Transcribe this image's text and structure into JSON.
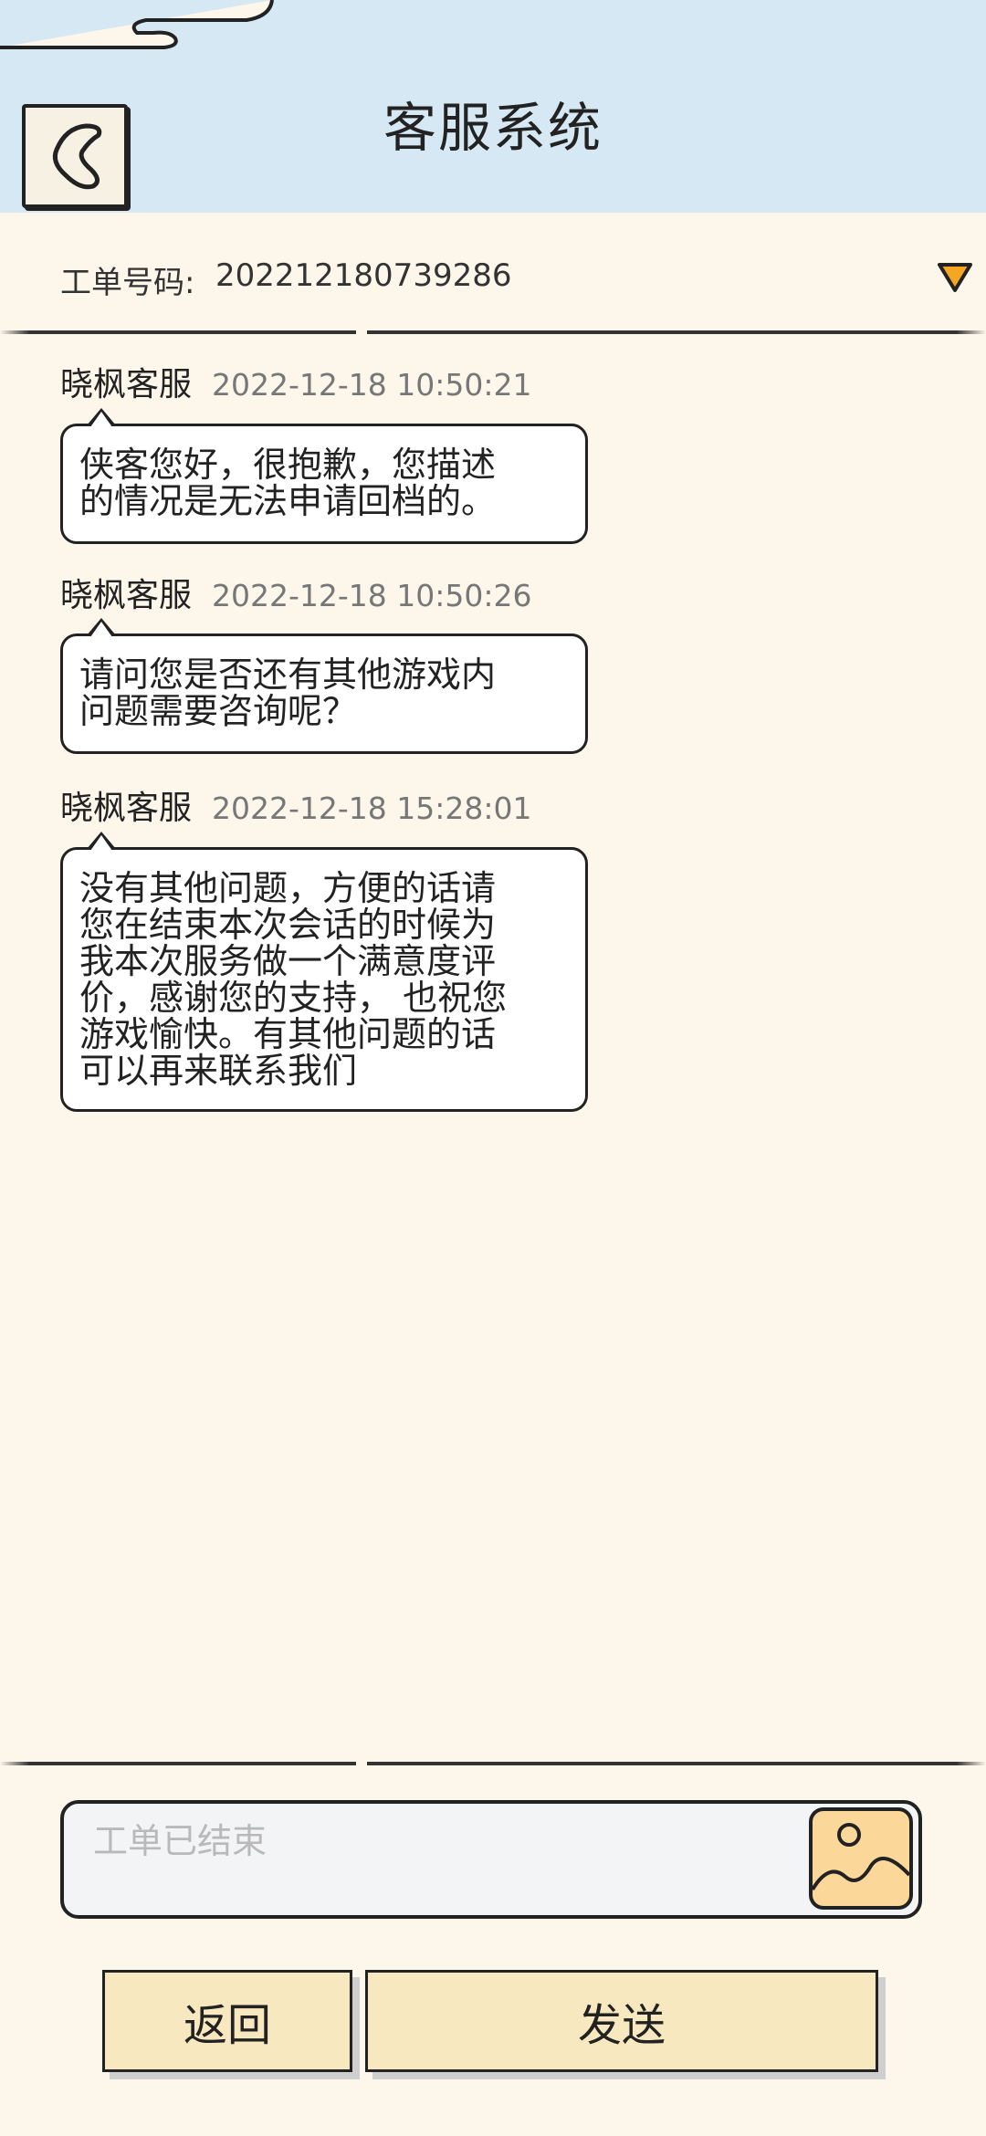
{
  "header": {
    "title": "客服系统",
    "back_icon": "chevron-left-icon"
  },
  "ticket": {
    "label": "工单号码:",
    "number": "202212180739286",
    "dropdown_icon": "triangle-down-icon"
  },
  "messages": [
    {
      "sender": "晓枫客服",
      "time": "2022-12-18 10:50:21",
      "lines": [
        "侠客您好，很抱歉，您描述",
        "的情况是无法申请回档的。"
      ]
    },
    {
      "sender": "晓枫客服",
      "time": "2022-12-18 10:50:26",
      "lines": [
        "请问您是否还有其他游戏内",
        "问题需要咨询呢？"
      ]
    },
    {
      "sender": "晓枫客服",
      "time": "2022-12-18 15:28:01",
      "lines": [
        "没有其他问题，方便的话请",
        "您在结束本次会话的时候为",
        "我本次服务做一个满意度评",
        "价，感谢您的支持， 也祝您",
        "游戏愉快。有其他问题的话",
        "可以再来联系我们"
      ]
    }
  ],
  "input": {
    "placeholder": "工单已结束",
    "image_icon": "image-icon"
  },
  "buttons": {
    "back_label": "返回",
    "send_label": "发送"
  },
  "colors": {
    "header_bg": "#d6e8f3",
    "page_bg": "#fdf6ea",
    "button_bg": "#f7e8c0",
    "dropdown": "#f5a623"
  }
}
